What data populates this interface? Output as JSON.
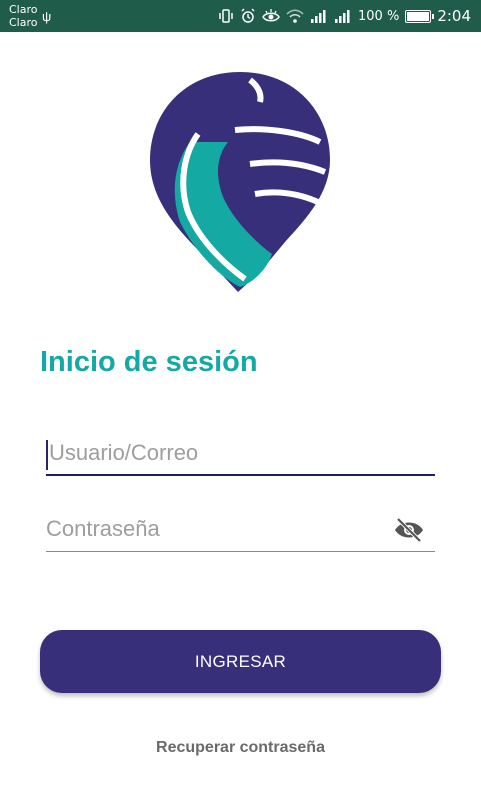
{
  "status_bar": {
    "carrier_line1": "Claro",
    "carrier_line2": "Claro",
    "battery_percent": "100 %",
    "time": "2:04",
    "icons": [
      "usb-icon",
      "vibrate-icon",
      "alarm-icon",
      "eye-comfort-icon",
      "wifi-icon",
      "signal-icon",
      "signal-icon",
      "battery-icon"
    ],
    "background_color": "#1f5c4a"
  },
  "logo": {
    "colors": {
      "purple": "#372f7a",
      "teal": "#14a9a2"
    }
  },
  "login": {
    "title": "Inicio de sesión",
    "username_placeholder": "Usuario/Correo",
    "username_value": "",
    "password_placeholder": "Contraseña",
    "password_value": "",
    "password_toggle_icon": "eye-off-icon",
    "submit_label": "INGRESAR",
    "recover_label": "Recuperar contraseña"
  },
  "colors": {
    "title": "#14a9a2",
    "button_bg": "#372f7a",
    "button_text": "#ffffff",
    "focused_underline": "#1f1a75",
    "link_text": "#6a6a6a"
  }
}
